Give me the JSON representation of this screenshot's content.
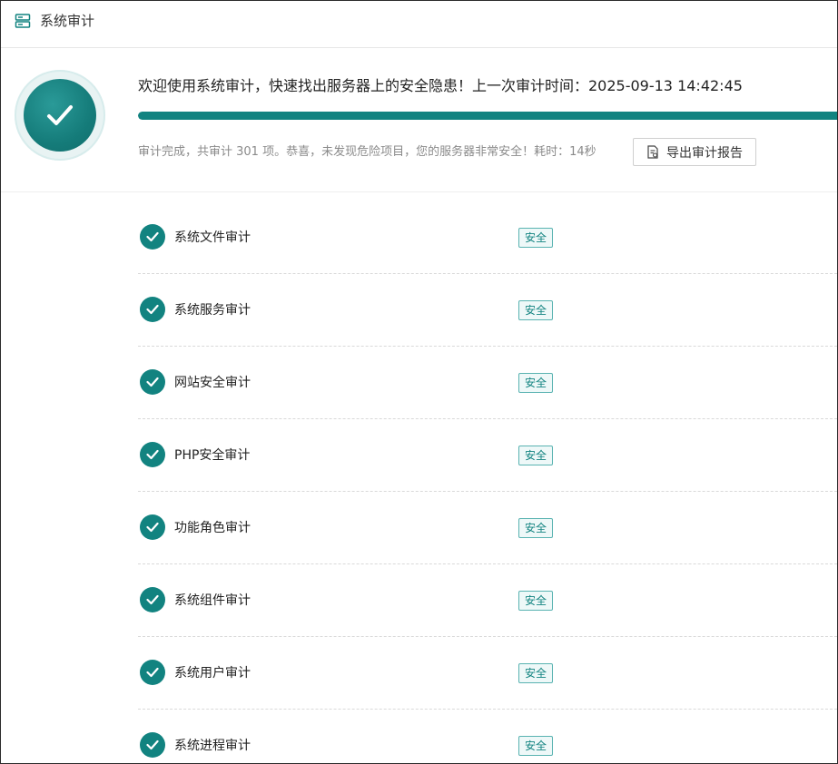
{
  "header": {
    "title": "系统审计",
    "icon": "server-icon"
  },
  "summary": {
    "welcome_text": "欢迎使用系统审计，快速找出服务器上的安全隐患！上一次审计时间：2025-09-13 14:42:45",
    "progress": 1.0,
    "result_text": "审计完成，共审计 301 项。恭喜，未发现危险项目，您的服务器非常安全！耗时：14秒",
    "export_button_label": "导出审计报告",
    "badge_icon": "checkmark-icon"
  },
  "colors": {
    "accent": "#128380",
    "tag_border": "#59b3b1",
    "tag_bg": "#eef8f8"
  },
  "audit_items": [
    {
      "label": "系统文件审计",
      "status": "安全"
    },
    {
      "label": "系统服务审计",
      "status": "安全"
    },
    {
      "label": "网站安全审计",
      "status": "安全"
    },
    {
      "label": "PHP安全审计",
      "status": "安全"
    },
    {
      "label": "功能角色审计",
      "status": "安全"
    },
    {
      "label": "系统组件审计",
      "status": "安全"
    },
    {
      "label": "系统用户审计",
      "status": "安全"
    },
    {
      "label": "系统进程审计",
      "status": "安全"
    }
  ]
}
